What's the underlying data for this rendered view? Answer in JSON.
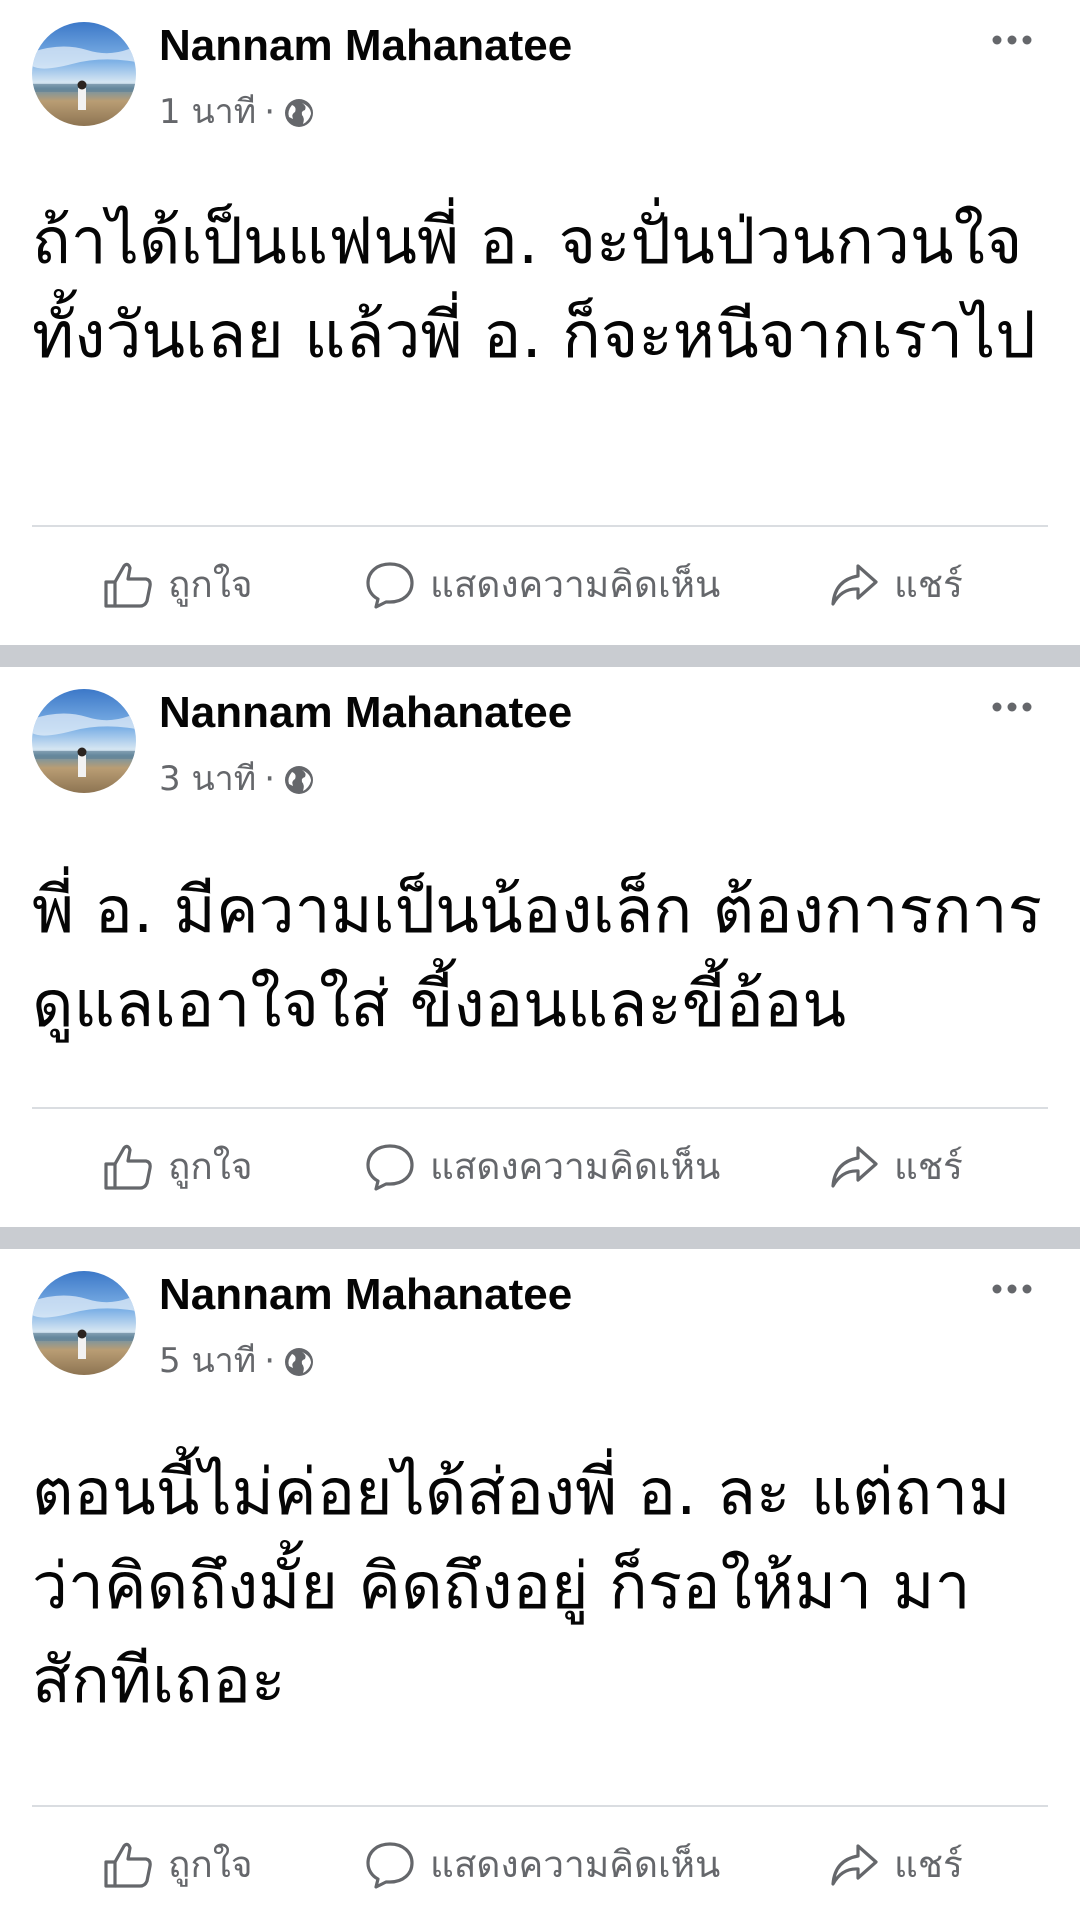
{
  "posts": [
    {
      "author": "Nannam Mahanatee",
      "time": "1 นาที",
      "separator": "·",
      "audience_icon": "globe-icon",
      "text": "ถ้าได้เป็นแฟนพี่ อ. จะปั่นป่วนกวนใจทั้งวันเลย แล้วพี่ อ. ก็จะหนีจากเราไป",
      "actions": {
        "like": "ถูกใจ",
        "comment": "แสดงความคิดเห็น",
        "share": "แชร์"
      }
    },
    {
      "author": "Nannam Mahanatee",
      "time": "3 นาที",
      "separator": "·",
      "audience_icon": "globe-icon",
      "text": "พี่ อ. มีความเป็นน้องเล็ก ต้องการการดูแลเอาใจใส่ ขี้งอนและขี้อ้อน",
      "actions": {
        "like": "ถูกใจ",
        "comment": "แสดงความคิดเห็น",
        "share": "แชร์"
      }
    },
    {
      "author": "Nannam Mahanatee",
      "time": "5 นาที",
      "separator": "·",
      "audience_icon": "globe-icon",
      "text": "ตอนนี้ไม่ค่อยได้ส่องพี่ อ. ละ แต่ถามว่าคิดถึงมั้ย คิดถึงอยู่ ก็รอให้มา มาสักทีเถอะ",
      "actions": {
        "like": "ถูกใจ",
        "comment": "แสดงความคิดเห็น",
        "share": "แชร์"
      }
    }
  ],
  "colors": {
    "text_primary": "#050505",
    "text_secondary": "#65676b",
    "divider": "#c9ccd1",
    "separator_line": "#dadde1"
  }
}
